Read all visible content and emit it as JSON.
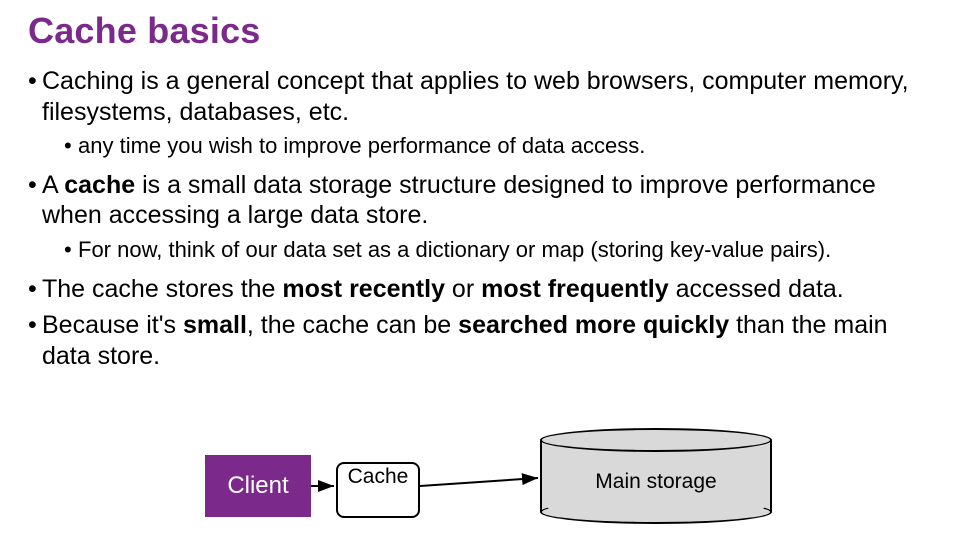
{
  "title": "Cache basics",
  "bullets": {
    "b1": "Caching is a general concept that applies to web browsers, computer memory, filesystems, databases, etc.",
    "b1a": "any time you wish to improve performance of data access.",
    "b2_pre": "A ",
    "b2_bold": "cache",
    "b2_post": " is a small data storage structure designed to improve performance when accessing a large data store.",
    "b2a": "For now, think of our data set as a dictionary or map (storing key-value pairs).",
    "b3_pre": "The cache stores the ",
    "b3_b1": "most recently",
    "b3_mid": " or ",
    "b3_b2": "most frequently",
    "b3_post": " accessed data.",
    "b4_pre": "Because it's ",
    "b4_b1": "small",
    "b4_mid": ", the cache can be ",
    "b4_b2": "searched more quickly",
    "b4_post": " than the main data store."
  },
  "diagram": {
    "client": "Client",
    "cache": "Cache",
    "storage": "Main storage"
  }
}
